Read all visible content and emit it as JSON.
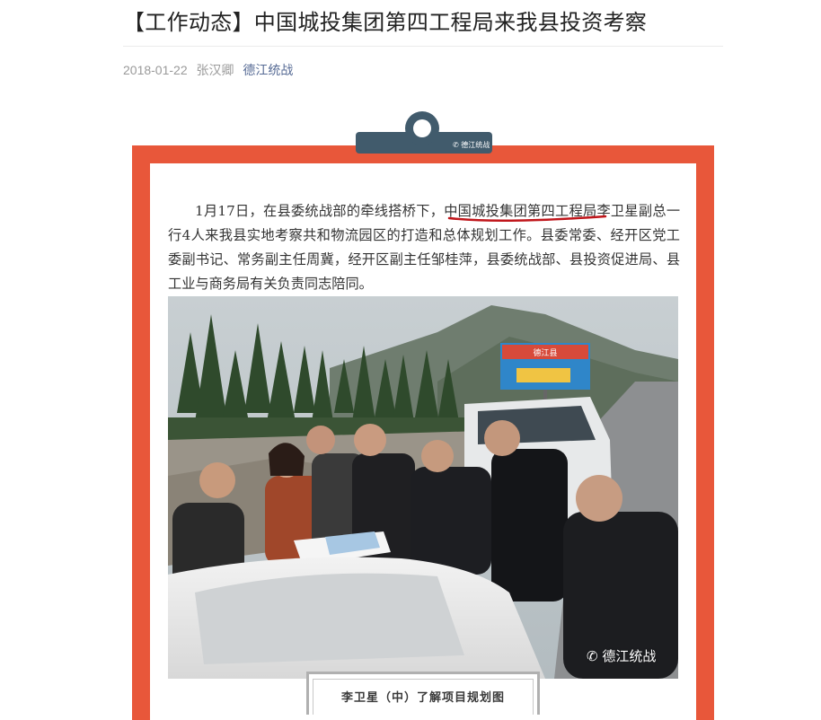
{
  "article": {
    "title": "【工作动态】中国城投集团第四工程局来我县投资考察",
    "date": "2018-01-22",
    "author": "张汉卿",
    "source": "德江统战"
  },
  "tag": {
    "logo_text": "德江统战"
  },
  "body": {
    "para_before": "1月17日，在县委统战部的牵线搭桥下，",
    "para_highlight": "中国城投集团第四工程局",
    "para_after": "李卫星副总一行4人来我县实地考察共和物流园区的打造和总体规划工作。县委常委、经开区党工委副书记、常务副主任周冀，经开区副主任邹桂萍，县委统战部、县投资促进局、县工业与商务局有关负责同志陪同。"
  },
  "photo": {
    "watermark": "德江统战",
    "billboard_text": "德江县"
  },
  "caption": "李卫星（中）了解项目规划图",
  "colors": {
    "frame": "#e8573a",
    "tag": "#415b6c",
    "source_link": "#576b95",
    "underline": "#c0161b"
  }
}
